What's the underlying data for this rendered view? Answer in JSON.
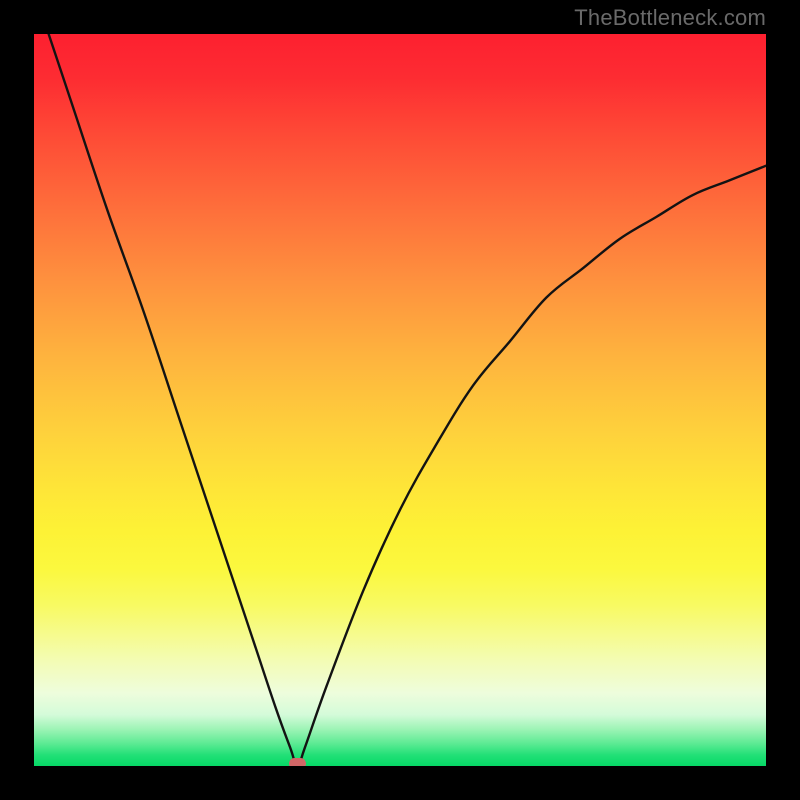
{
  "watermark": {
    "text": "TheBottleneck.com"
  },
  "colors": {
    "frame": "#000000",
    "curve_stroke": "#131313",
    "dot_fill": "#d16767",
    "watermark": "#6a6a6a"
  },
  "chart_data": {
    "type": "line",
    "title": "",
    "xlabel": "",
    "ylabel": "",
    "xlim": [
      0,
      100
    ],
    "ylim": [
      0,
      100
    ],
    "grid": false,
    "legend": false,
    "note": "Axes and ticks are not drawn; values are read off implied 0–100 scales in both directions. The plotted curve is |f(x)| for a function reaching 0 at x≈36; y=100 corresponds to the top edge and y=0 to the bottom.",
    "x": [
      0,
      5,
      10,
      15,
      20,
      25,
      30,
      33,
      35,
      36,
      37,
      40,
      45,
      50,
      55,
      60,
      65,
      70,
      75,
      80,
      85,
      90,
      95,
      100
    ],
    "values": [
      106,
      91,
      76,
      62,
      47,
      32,
      17,
      8,
      2.5,
      0,
      2.5,
      11,
      24,
      35,
      44,
      52,
      58,
      64,
      68,
      72,
      75,
      78,
      80,
      82
    ],
    "marker": {
      "x": 36,
      "y": 0,
      "label": ""
    },
    "background_gradient": {
      "direction": "top-to-bottom",
      "stops": [
        {
          "pos": 0.0,
          "color": "#fd2030"
        },
        {
          "pos": 0.24,
          "color": "#fe6f3b"
        },
        {
          "pos": 0.54,
          "color": "#fed03c"
        },
        {
          "pos": 0.73,
          "color": "#fbf83e"
        },
        {
          "pos": 0.9,
          "color": "#eefddc"
        },
        {
          "pos": 1.0,
          "color": "#06d966"
        }
      ]
    }
  }
}
